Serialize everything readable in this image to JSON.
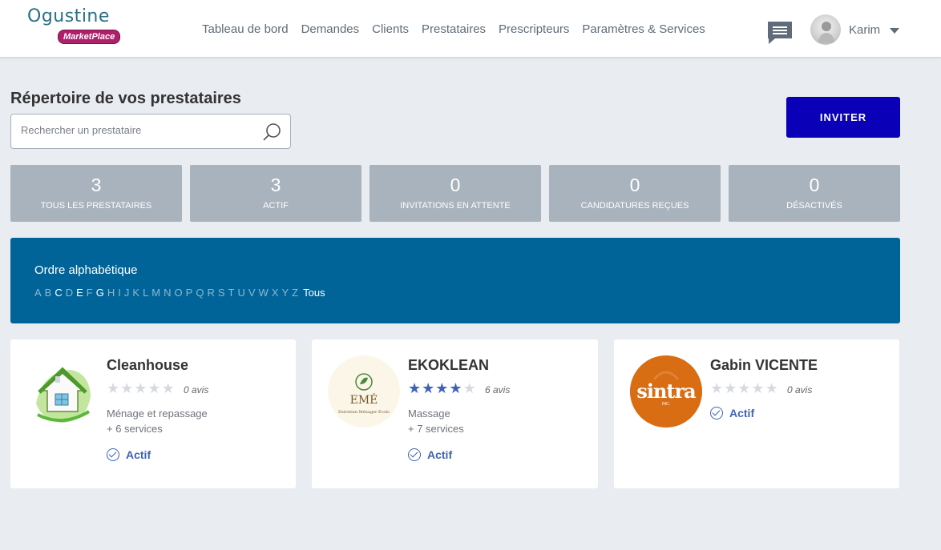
{
  "brand": {
    "name": "Ogustine",
    "badge": "MarketPlace"
  },
  "nav": [
    "Tableau de bord",
    "Demandes",
    "Clients",
    "Prestataires",
    "Prescripteurs",
    "Paramètres & Services"
  ],
  "user": {
    "name": "Karim"
  },
  "page": {
    "title": "Répertoire de vos prestataires",
    "search_placeholder": "Rechercher un prestataire",
    "invite_label": "INVITER"
  },
  "stats": [
    {
      "value": "3",
      "label": "TOUS LES PRESTATAIRES"
    },
    {
      "value": "3",
      "label": "ACTIF"
    },
    {
      "value": "0",
      "label": "INVITATIONS EN ATTENTE"
    },
    {
      "value": "0",
      "label": "CANDIDATURES REÇUES"
    },
    {
      "value": "0",
      "label": "DÉSACTIVÉS"
    }
  ],
  "alphabet": {
    "title": "Ordre alphabétique",
    "letters": [
      "A",
      "B",
      "C",
      "D",
      "E",
      "F",
      "G",
      "H",
      "I",
      "J",
      "K",
      "L",
      "M",
      "N",
      "O",
      "P",
      "Q",
      "R",
      "S",
      "T",
      "U",
      "V",
      "W",
      "X",
      "Y",
      "Z"
    ],
    "active_letters": [
      "C",
      "E",
      "G"
    ],
    "all_label": "Tous"
  },
  "providers": [
    {
      "name": "Cleanhouse",
      "rating": 0,
      "reviews": "0 avis",
      "service": "Ménage et repassage",
      "more": "+ 6 services",
      "status": "Actif"
    },
    {
      "name": "EKOKLEAN",
      "rating": 4,
      "reviews": "6 avis",
      "service": "Massage",
      "more": "+ 7 services",
      "status": "Actif",
      "logo_text": "EMÉ",
      "logo_sub": "Entretien Ménager Écolo"
    },
    {
      "name": "Gabin VICENTE",
      "rating": 0,
      "reviews": "0 avis",
      "status": "Actif",
      "logo_text": "sintra",
      "logo_sub": "INC."
    }
  ],
  "colors": {
    "invite": "#0a00b8",
    "alpha_bar": "#006499",
    "stat_bg": "#a9b3bd",
    "accent": "#3f63b4"
  }
}
